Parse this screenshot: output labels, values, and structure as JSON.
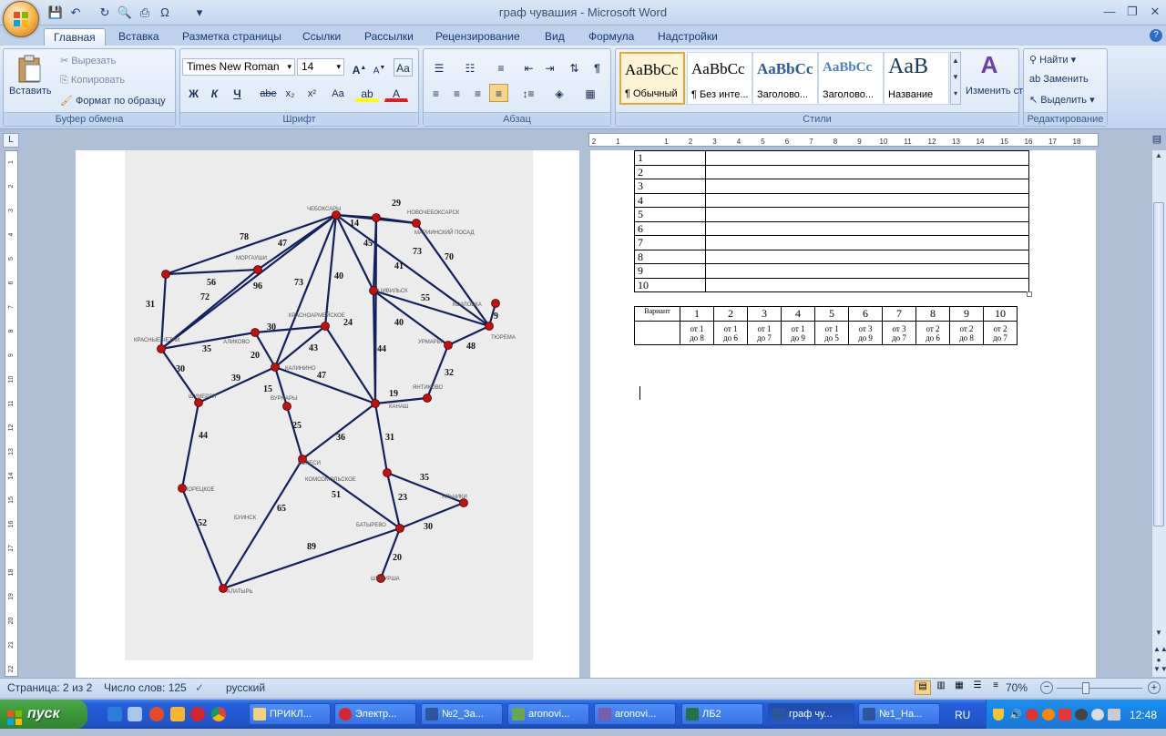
{
  "title": "граф чувашия - Microsoft Word",
  "tabs": [
    "Главная",
    "Вставка",
    "Разметка страницы",
    "Ссылки",
    "Рассылки",
    "Рецензирование",
    "Вид",
    "Формула",
    "Надстройки"
  ],
  "ribbon": {
    "clipboard": {
      "label": "Буфер обмена",
      "paste": "Вставить",
      "cut": "Вырезать",
      "copy": "Копировать",
      "format_painter": "Формат по образцу"
    },
    "font": {
      "label": "Шрифт",
      "font_name": "Times New Roman",
      "font_size": "14",
      "bold": "Ж",
      "italic": "К",
      "underline": "Ч",
      "strike": "abe",
      "sub": "x₂",
      "sup": "x²",
      "case": "Аа"
    },
    "paragraph": {
      "label": "Абзац"
    },
    "styles": {
      "label": "Стили",
      "tiles": [
        {
          "sample": "AaBbCc",
          "name": "¶ Обычный"
        },
        {
          "sample": "AaBbCc",
          "name": "¶ Без инте..."
        },
        {
          "sample": "AaBbCc",
          "name": "Заголово..."
        },
        {
          "sample": "AaBbCc",
          "name": "Заголово..."
        },
        {
          "sample": "AaB",
          "name": "Название"
        }
      ],
      "change": "Изменить стили"
    },
    "editing": {
      "label": "Редактирование",
      "find": "Найти",
      "replace": "Заменить",
      "select": "Выделить"
    }
  },
  "map": {
    "cities": [
      "ЧЕБОКСАРЫ",
      "НОВОЧЕБОКСАРСК",
      "МАРИИНСКИЙ ПОСАД",
      "МОРГАУШИ",
      "ЦИВИЛЬСК",
      "КРАСНОАРМЕЙСКОЕ",
      "КРАСНЫЕ ЧЕТАИ",
      "АЛИКОВО",
      "КАЛИНИНО",
      "ШУМЕРЛЯ",
      "ВУРНАРЫ",
      "КАНАШ",
      "УРМАРЫ",
      "КОЗЛОВКА",
      "ЯНТИКОВО",
      "ИБРЕСИ",
      "КОМСОМОЛЬСКОЕ",
      "ПОРЕЦКОЕ",
      "БАТЫРЕВО",
      "ЯЛЬЧИКИ",
      "БУИНСК",
      "ШЕМУРША",
      "АЛАТЫРЬ",
      "ТЮРЕМА"
    ],
    "edge_labels": [
      "29",
      "14",
      "78",
      "47",
      "45",
      "73",
      "70",
      "56",
      "96",
      "73",
      "40",
      "41",
      "72",
      "55",
      "31",
      "30",
      "24",
      "40",
      "9",
      "35",
      "20",
      "43",
      "44",
      "48",
      "30",
      "39",
      "47",
      "15",
      "19",
      "32",
      "25",
      "44",
      "36",
      "31",
      "35",
      "51",
      "23",
      "65",
      "52",
      "30",
      "89",
      "20"
    ]
  },
  "table1": {
    "rows": [
      "1",
      "2",
      "3",
      "4",
      "5",
      "6",
      "7",
      "8",
      "9",
      "10"
    ]
  },
  "table2": {
    "header": "Вариант",
    "variants": [
      "1",
      "2",
      "3",
      "4",
      "5",
      "6",
      "7",
      "8",
      "9",
      "10"
    ],
    "ranges_top": [
      "от 1",
      "от 1",
      "от 1",
      "от 1",
      "от 1",
      "от 3",
      "от 3",
      "от 2",
      "от 2",
      "от 2"
    ],
    "ranges_bottom": [
      "до 8",
      "до 6",
      "до 7",
      "до 9",
      "до 5",
      "до 9",
      "до 7",
      "до 6",
      "до 8",
      "до 7"
    ]
  },
  "status": {
    "page": "Страница: 2 из 2",
    "words": "Число слов: 125",
    "lang": "русский",
    "zoom": "70%"
  },
  "taskbar": {
    "start": "пуск",
    "items": [
      "ПРИКЛ...",
      "Электр...",
      "№2_За...",
      "aronovi...",
      "aronovi...",
      "ЛБ2",
      "граф чу...",
      "№1_На..."
    ],
    "lang": "RU",
    "time": "12:48"
  }
}
